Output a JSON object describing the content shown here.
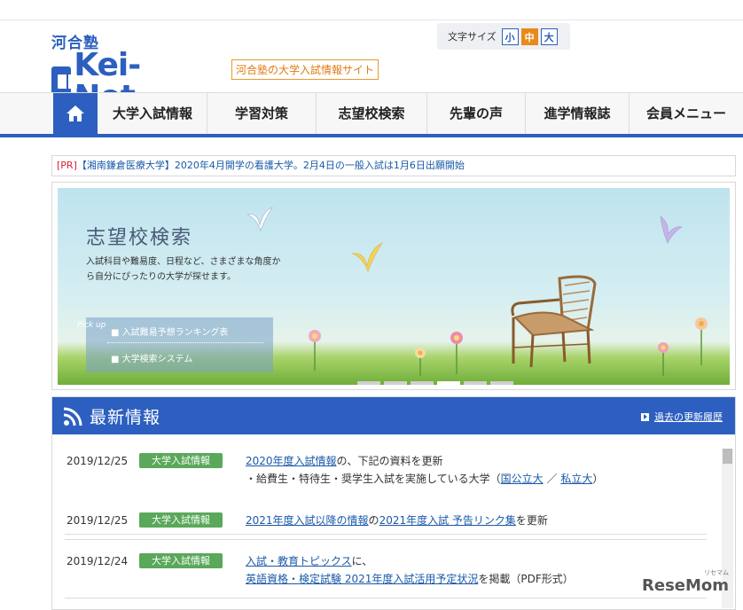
{
  "header": {
    "logo_kana": "河合塾",
    "logo_text": "Kei-Net",
    "tagline": "河合塾の大学入試情報サイト",
    "font_size_label": "文字サイズ",
    "font_sizes": [
      "小",
      "中",
      "大"
    ],
    "font_size_selected": "中"
  },
  "nav": {
    "home_icon": "home-icon",
    "items": [
      "大学入試情報",
      "学習対策",
      "志望校検索",
      "先輩の声",
      "進学情報誌",
      "会員メニュー"
    ]
  },
  "ticker": {
    "pr": "[PR]",
    "text": "【湘南鎌倉医療大学】2020年4月開学の看護大学。2月4日の一般入試は1月6日出願開始"
  },
  "banner": {
    "title": "志望校検索",
    "description": "入試科目や難易度、日程など、さまざまな角度から自分にぴったりの大学が探せます。",
    "pickup_label": "Pick up",
    "pickup_items": [
      "入試難易予想ランキング表",
      "大学検索システム"
    ],
    "slide_count": 6,
    "active_slide": 4
  },
  "news": {
    "title": "最新情報",
    "more_link": "過去の更新履歴",
    "rows": [
      {
        "date": "2019/12/25",
        "badge": "大学入試情報",
        "line1_link": "2020年度入試情報",
        "line1_rest": "の、下記の資料を更新",
        "line2_pre": "・給費生・特待生・奨学生入試を実施している大学（",
        "line2_link1": "国公立大",
        "line2_mid": "／",
        "line2_link2": "私立大",
        "line2_post": "）"
      },
      {
        "date": "2019/12/25",
        "badge": "大学入試情報",
        "link1": "2021年度入試以降の情報",
        "mid": "の",
        "link2": "2021年度入試 予告リンク集",
        "rest": "を更新"
      },
      {
        "date": "2019/12/24",
        "badge": "大学入試情報",
        "line1_link": "入試・教育トピックス",
        "line1_rest": "に、",
        "line2_link": "英語資格・検定試験 2021年度入試活用予定状況",
        "line2_rest": "を掲載（PDF形式）"
      }
    ]
  },
  "watermark": {
    "text": "ReseMom",
    "sub": "リセマム"
  },
  "colors": {
    "brand_blue": "#2c5fbf",
    "accent_orange": "#e88a1a",
    "badge_green": "#5aa85a",
    "link_blue": "#1a5aa8"
  }
}
